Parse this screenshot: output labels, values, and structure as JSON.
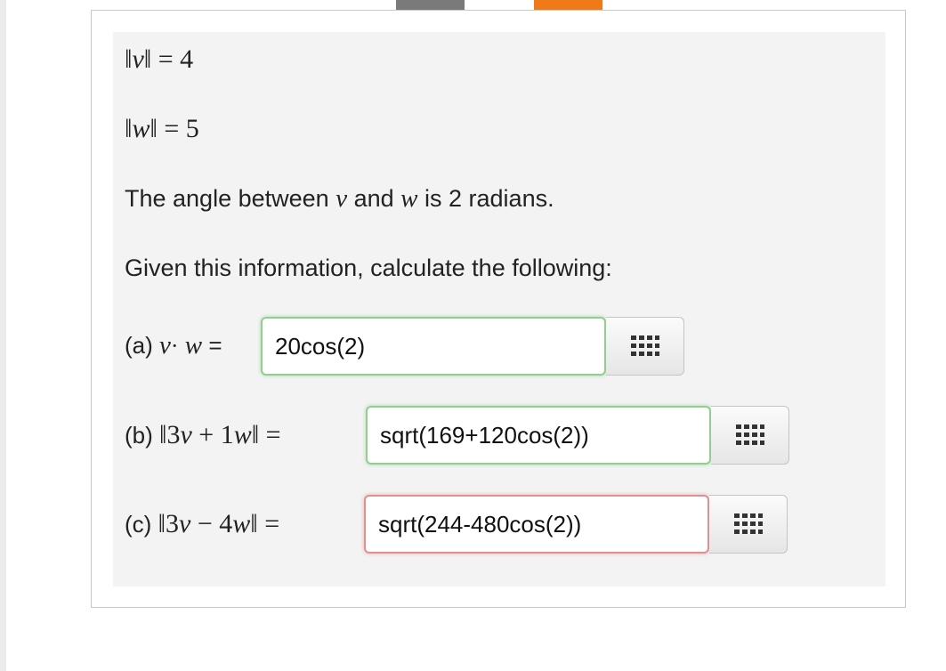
{
  "given": {
    "norm_v": {
      "symbol": "v",
      "value": "4"
    },
    "norm_w": {
      "symbol": "w",
      "value": "5"
    },
    "angle_sentence": {
      "prefix": "The angle between",
      "var1": "v",
      "middle": "and",
      "var2": "w",
      "suffix": "is 2 radians."
    },
    "instruction": "Given this information, calculate the following:"
  },
  "parts": [
    {
      "label": "(a)",
      "answer": "20cos(2)",
      "status": "correct"
    },
    {
      "label": "(b)",
      "answer": "sqrt(169+120cos(2))",
      "status": "correct"
    },
    {
      "label": "(c)",
      "answer": "sqrt(244-480cos(2))",
      "status": "incorrect"
    }
  ],
  "colors": {
    "correct_border": "#8fcf8f",
    "incorrect_border": "#e09090",
    "accent_tab": "#ee7b17",
    "panel_bg": "#f3f3f3"
  },
  "icons": {
    "keypad": "keypad-grid-icon"
  }
}
